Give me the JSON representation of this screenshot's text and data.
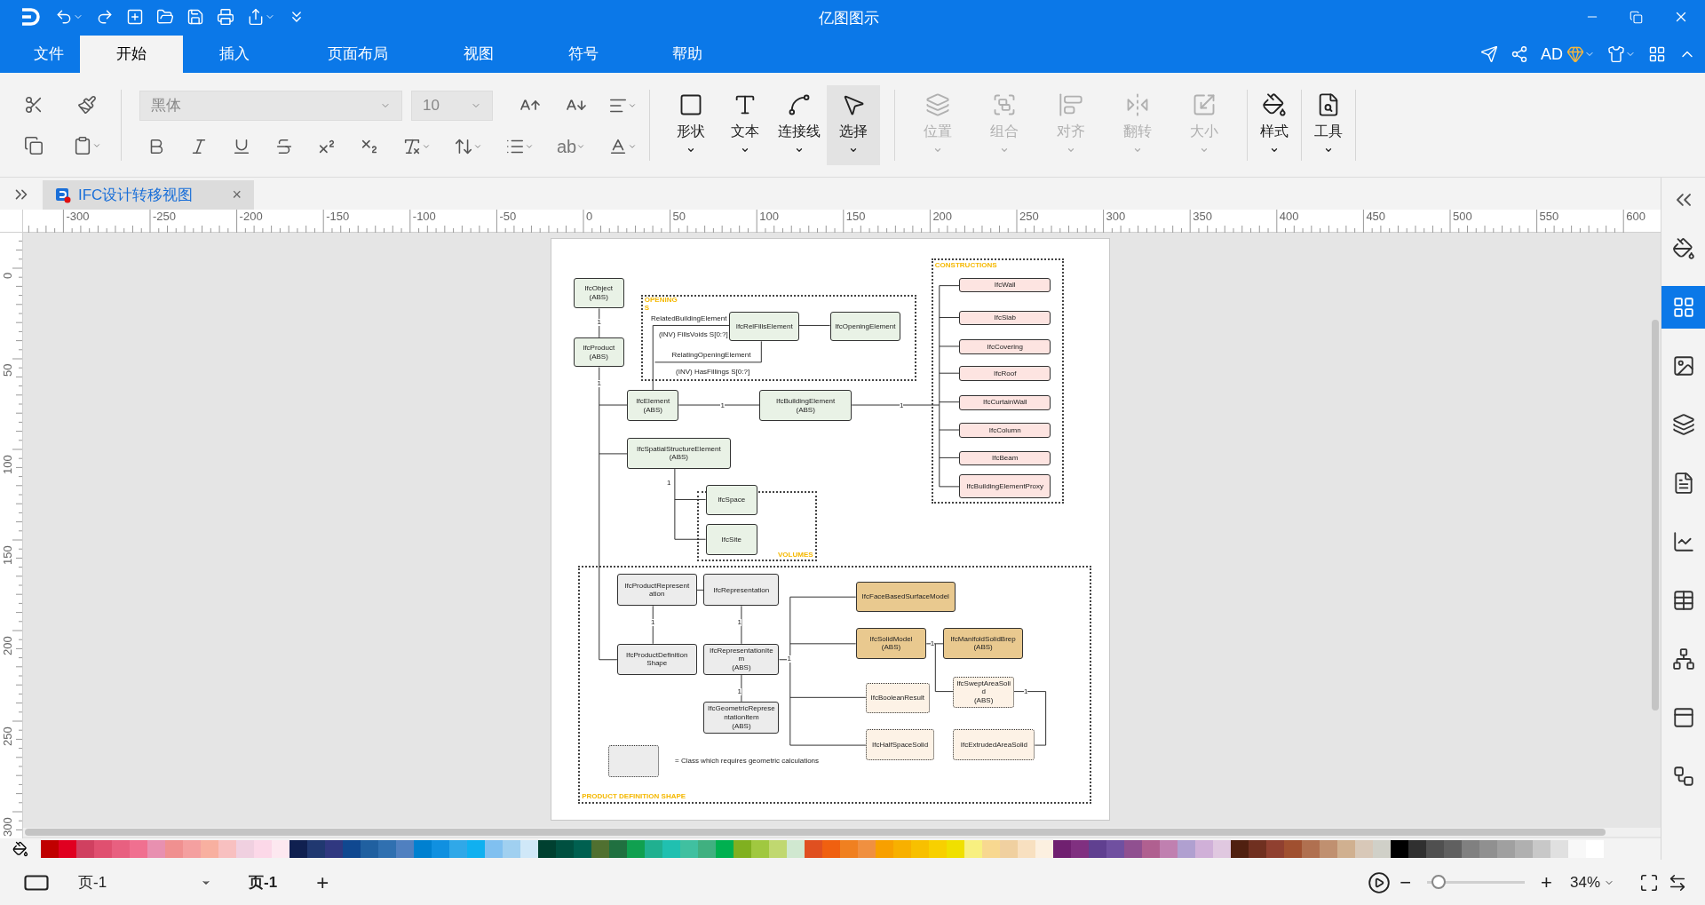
{
  "app_title": "亿图图示",
  "menu_tabs": [
    {
      "label": "文件",
      "selected": false
    },
    {
      "label": "开始",
      "selected": true
    },
    {
      "label": "插入",
      "selected": false
    },
    {
      "label": "页面布局",
      "selected": false
    },
    {
      "label": "视图",
      "selected": false
    },
    {
      "label": "符号",
      "selected": false
    },
    {
      "label": "帮助",
      "selected": false
    }
  ],
  "account": {
    "label": "AD"
  },
  "ribbon": {
    "font_field": {
      "value": "黑体"
    },
    "size_field": {
      "value": "10"
    },
    "text_effect": "ab",
    "large_buttons": [
      {
        "label": "形状",
        "selected": false,
        "disabled": false
      },
      {
        "label": "文本",
        "selected": false,
        "disabled": false
      },
      {
        "label": "连接线",
        "selected": false,
        "disabled": false
      },
      {
        "label": "选择",
        "selected": true,
        "disabled": false
      },
      {
        "label": "位置",
        "selected": false,
        "disabled": true
      },
      {
        "label": "组合",
        "selected": false,
        "disabled": true
      },
      {
        "label": "对齐",
        "selected": false,
        "disabled": true
      },
      {
        "label": "翻转",
        "selected": false,
        "disabled": true
      },
      {
        "label": "大小",
        "selected": false,
        "disabled": true
      },
      {
        "label": "样式",
        "selected": false,
        "disabled": false
      },
      {
        "label": "工具",
        "selected": false,
        "disabled": false
      }
    ]
  },
  "document_tab": {
    "title": "IFC设计转移视图",
    "close": "×"
  },
  "ruler": {
    "x_labels": [
      "-300",
      "-250",
      "-200",
      "-150",
      "-100",
      "-50",
      "0",
      "50",
      "100",
      "150",
      "200",
      "250",
      "300",
      "350",
      "400",
      "450",
      "500",
      "550",
      "600"
    ],
    "y_labels": [
      "0",
      "50",
      "100",
      "150",
      "200",
      "250",
      "300"
    ]
  },
  "diagram": {
    "groups": [
      {
        "label": "OPENINGS"
      },
      {
        "label": "CONSTRUCTIONS"
      },
      {
        "label": "VOLUMES"
      },
      {
        "label": "PRODUCT DEFINITION SHAPE"
      }
    ],
    "nodes": [
      {
        "lines": [
          "IfcObject",
          "(ABS)"
        ],
        "kind": "green"
      },
      {
        "lines": [
          "IfcProduct",
          "(ABS)"
        ],
        "kind": "green"
      },
      {
        "lines": [
          "IfcRelFillsElement"
        ],
        "kind": "green"
      },
      {
        "lines": [
          "IfcOpeningElement"
        ],
        "kind": "green"
      },
      {
        "lines": [
          "IfcElement",
          "(ABS)"
        ],
        "kind": "green"
      },
      {
        "lines": [
          "IfcBuildingElement",
          "(ABS)"
        ],
        "kind": "green"
      },
      {
        "lines": [
          "IfcSpatialStructureElement",
          "(ABS)"
        ],
        "kind": "green"
      },
      {
        "lines": [
          "IfcSpace"
        ],
        "kind": "green"
      },
      {
        "lines": [
          "IfcSite"
        ],
        "kind": "green"
      },
      {
        "lines": [
          "IfcWall"
        ],
        "kind": "pink"
      },
      {
        "lines": [
          "IfcSlab"
        ],
        "kind": "pink"
      },
      {
        "lines": [
          "IfcCovering"
        ],
        "kind": "pink"
      },
      {
        "lines": [
          "IfcRoof"
        ],
        "kind": "pink"
      },
      {
        "lines": [
          "IfcCurtainWall"
        ],
        "kind": "pink"
      },
      {
        "lines": [
          "IfcColumn"
        ],
        "kind": "pink"
      },
      {
        "lines": [
          "IfcBeam"
        ],
        "kind": "pink"
      },
      {
        "lines": [
          "IfcBuildingElementProxy"
        ],
        "kind": "pink"
      },
      {
        "lines": [
          "IfcProductRepresent",
          "ation"
        ],
        "kind": "gray"
      },
      {
        "lines": [
          "IfcRepresentation"
        ],
        "kind": "gray"
      },
      {
        "lines": [
          "IfcProductDefinition",
          "Shape"
        ],
        "kind": "gray"
      },
      {
        "lines": [
          "IfcRepresentationIte",
          "m",
          "(ABS)"
        ],
        "kind": "gray"
      },
      {
        "lines": [
          "IfcGeometricReprese",
          "ntationItem",
          "(ABS)"
        ],
        "kind": "gray"
      },
      {
        "lines": [
          "IfcFaceBasedSurfaceModel"
        ],
        "kind": "tan"
      },
      {
        "lines": [
          "IfcSolidModel",
          "(ABS)"
        ],
        "kind": "tan"
      },
      {
        "lines": [
          "IfcManifoldSolidBrep",
          "(ABS)"
        ],
        "kind": "tan"
      },
      {
        "lines": [
          "IfcBooleanResult"
        ],
        "kind": "dashed"
      },
      {
        "lines": [
          "IfcSweptAreaSoli",
          "d",
          "(ABS)"
        ],
        "kind": "dashed"
      },
      {
        "lines": [
          "IfcHalfSpaceSolid"
        ],
        "kind": "dashed"
      },
      {
        "lines": [
          "IfcExtrudedAreaSolid"
        ],
        "kind": "dashed"
      }
    ],
    "role_labels": [
      "RelatedBuildingElement",
      "(INV) FillsVoids S[0:?]",
      "RelatingOpeningElement",
      "(INV) HasFillings S[0:?]"
    ],
    "multiplicities": [
      "1",
      "1",
      "1",
      "1",
      "1",
      "1",
      "1",
      "1",
      "1",
      "1",
      "1"
    ],
    "legend_text": "= Class which requires geometric calculations"
  },
  "palette": [
    {
      "color": "#c00000"
    },
    {
      "color": "#e00020"
    },
    {
      "color": "#d04060"
    },
    {
      "color": "#e05070"
    },
    {
      "color": "#e86080"
    },
    {
      "color": "#f07090"
    },
    {
      "color": "#e890b0"
    },
    {
      "color": "#f09090"
    },
    {
      "color": "#f4a0a0"
    },
    {
      "color": "#f8b0a0"
    },
    {
      "color": "#f8c0c0"
    },
    {
      "color": "#f0d0e0"
    },
    {
      "color": "#fcd8e8"
    },
    {
      "color": "#fde8f0"
    },
    {
      "color": "#102050"
    },
    {
      "color": "#203870"
    },
    {
      "color": "#303880"
    },
    {
      "color": "#104890"
    },
    {
      "color": "#2060a0"
    },
    {
      "color": "#3070b0"
    },
    {
      "color": "#5080c0"
    },
    {
      "color": "#0080d0"
    },
    {
      "color": "#1090e0"
    },
    {
      "color": "#30a8e8"
    },
    {
      "color": "#10b0f0"
    },
    {
      "color": "#80c0f0"
    },
    {
      "color": "#a0d0f0"
    },
    {
      "color": "#d0e8f8"
    },
    {
      "color": "#004030"
    },
    {
      "color": "#005040"
    },
    {
      "color": "#006050"
    },
    {
      "color": "#507030"
    },
    {
      "color": "#207040"
    },
    {
      "color": "#10a050"
    },
    {
      "color": "#20b090"
    },
    {
      "color": "#20c0b0"
    },
    {
      "color": "#40c0a0"
    },
    {
      "color": "#40b080"
    },
    {
      "color": "#00b050"
    },
    {
      "color": "#80b020"
    },
    {
      "color": "#a0c840"
    },
    {
      "color": "#c0d870"
    },
    {
      "color": "#d0e8d0"
    },
    {
      "color": "#e05020"
    },
    {
      "color": "#f06010"
    },
    {
      "color": "#f08020"
    },
    {
      "color": "#f09040"
    },
    {
      "color": "#f8a000"
    },
    {
      "color": "#f8b000"
    },
    {
      "color": "#f8c000"
    },
    {
      "color": "#f8d000"
    },
    {
      "color": "#f0e000"
    },
    {
      "color": "#f8f080"
    },
    {
      "color": "#f8d890"
    },
    {
      "color": "#f0d0a0"
    },
    {
      "color": "#f8e0c0"
    },
    {
      "color": "#fcf0e0"
    },
    {
      "color": "#702070"
    },
    {
      "color": "#803080"
    },
    {
      "color": "#604090"
    },
    {
      "color": "#7050a0"
    },
    {
      "color": "#905090"
    },
    {
      "color": "#b06090"
    },
    {
      "color": "#c080b0"
    },
    {
      "color": "#b0a0d0"
    },
    {
      "color": "#d0b0d8"
    },
    {
      "color": "#e0c8e0"
    },
    {
      "color": "#502010"
    },
    {
      "color": "#703020"
    },
    {
      "color": "#904030"
    },
    {
      "color": "#a05030"
    },
    {
      "color": "#b07050"
    },
    {
      "color": "#c09070"
    },
    {
      "color": "#d0b090"
    },
    {
      "color": "#d8c8b8"
    },
    {
      "color": "#d0d0c8"
    },
    {
      "color": "#000000"
    },
    {
      "color": "#303030"
    },
    {
      "color": "#505050"
    },
    {
      "color": "#606060"
    },
    {
      "color": "#808080"
    },
    {
      "color": "#909090"
    },
    {
      "color": "#a0a0a0"
    },
    {
      "color": "#b0b0b0"
    },
    {
      "color": "#c8c8c8"
    },
    {
      "color": "#e0e0e0"
    },
    {
      "color": "#f8f8f8"
    },
    {
      "color": "#ffffff"
    }
  ],
  "sidebar": {
    "items": [
      {
        "selected": false
      },
      {
        "selected": true
      },
      {
        "selected": false
      },
      {
        "selected": false
      },
      {
        "selected": false
      },
      {
        "selected": false
      },
      {
        "selected": false
      },
      {
        "selected": false
      },
      {
        "selected": false
      },
      {
        "selected": false
      }
    ]
  },
  "status_bar": {
    "page_select": "页-1",
    "page_tab": "页-1",
    "add": "+",
    "zoom_out": "−",
    "zoom_in": "+",
    "zoom": {
      "level": 0.12
    },
    "zoom_value": "34%"
  }
}
